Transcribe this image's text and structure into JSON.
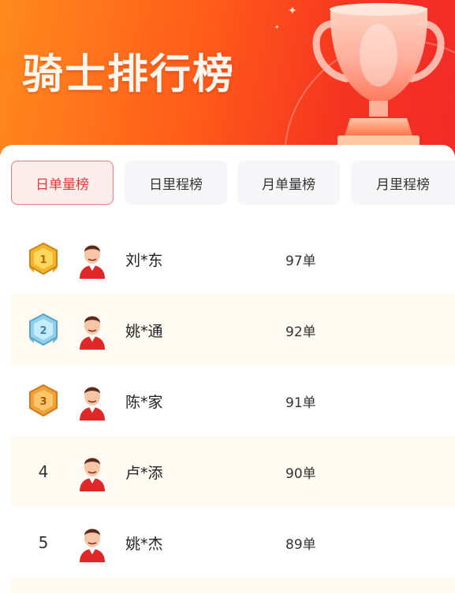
{
  "header": {
    "title": "骑士排行榜"
  },
  "tabs": [
    {
      "label": "日单量榜",
      "active": true
    },
    {
      "label": "日里程榜",
      "active": false
    },
    {
      "label": "月单量榜",
      "active": false
    },
    {
      "label": "月里程榜",
      "active": false
    }
  ],
  "rows": [
    {
      "rank": "1",
      "medal": "gold",
      "name": "刘*东",
      "count": "97单"
    },
    {
      "rank": "2",
      "medal": "silver",
      "name": "姚*通",
      "count": "92单"
    },
    {
      "rank": "3",
      "medal": "bronze",
      "name": "陈*家",
      "count": "91单"
    },
    {
      "rank": "4",
      "medal": "",
      "name": "卢*添",
      "count": "90单"
    },
    {
      "rank": "5",
      "medal": "",
      "name": "姚*杰",
      "count": "89单"
    }
  ],
  "colors": {
    "accent": "#e83a3a",
    "header_gradient_start": "#ff8a1e",
    "header_gradient_end": "#f22a28",
    "alt_row": "#fffaf2"
  },
  "icons": [
    "trophy-icon",
    "gold-medal-icon",
    "silver-medal-icon",
    "bronze-medal-icon",
    "rider-avatar"
  ]
}
